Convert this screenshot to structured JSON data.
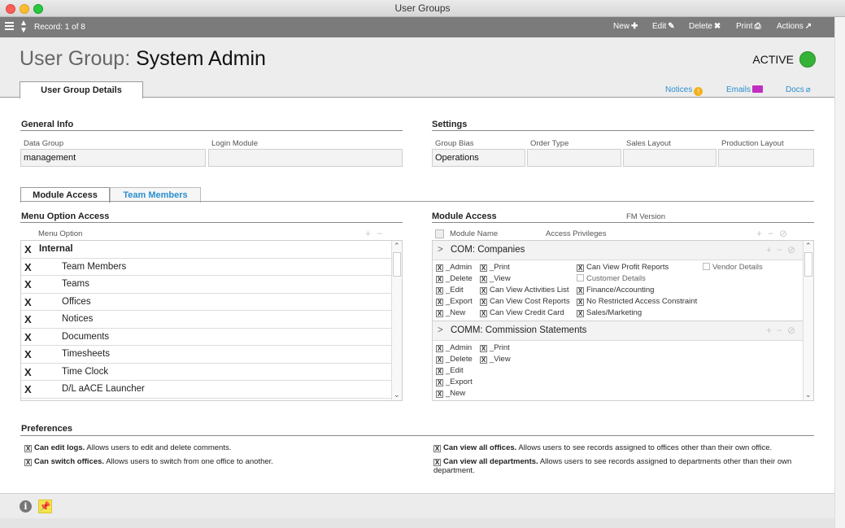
{
  "window": {
    "title": "User Groups"
  },
  "toolbar": {
    "record_label": "Record: 1 of 8",
    "new_label": "New",
    "edit_label": "Edit",
    "delete_label": "Delete",
    "print_label": "Print",
    "actions_label": "Actions"
  },
  "header": {
    "title_prefix": "User Group:",
    "title_name": "System Admin",
    "status": "ACTIVE",
    "status_color": "#36b236",
    "main_tab": "User Group Details",
    "links": {
      "notices": "Notices",
      "emails": "Emails",
      "docs": "Docs"
    }
  },
  "general_info": {
    "title": "General Info",
    "data_group_label": "Data Group",
    "data_group_value": "management",
    "login_module_label": "Login Module",
    "login_module_value": ""
  },
  "settings": {
    "title": "Settings",
    "group_bias_label": "Group Bias",
    "group_bias_value": "Operations",
    "order_type_label": "Order Type",
    "order_type_value": "",
    "sales_layout_label": "Sales Layout",
    "sales_layout_value": "",
    "production_layout_label": "Production Layout",
    "production_layout_value": ""
  },
  "subtabs": {
    "module_access": "Module Access",
    "team_members": "Team Members"
  },
  "menu_option_access": {
    "title": "Menu Option Access",
    "column_header": "Menu Option",
    "rows": [
      {
        "label": "Internal",
        "checked": "X",
        "group": true
      },
      {
        "label": "Team Members",
        "checked": "X"
      },
      {
        "label": "Teams",
        "checked": "X"
      },
      {
        "label": "Offices",
        "checked": "X"
      },
      {
        "label": "Notices",
        "checked": "X"
      },
      {
        "label": "Documents",
        "checked": "X"
      },
      {
        "label": "Timesheets",
        "checked": "X"
      },
      {
        "label": "Time Clock",
        "checked": "X"
      },
      {
        "label": "D/L aACE Launcher",
        "checked": "X"
      }
    ]
  },
  "module_access": {
    "title": "Module Access",
    "fm_version_label": "FM Version",
    "col_module_name": "Module Name",
    "col_access_privileges": "Access Privileges",
    "modules": [
      {
        "name": "COM: Companies",
        "privileges": {
          "admin": "_Admin",
          "delete": "_Delete",
          "edit": "_Edit",
          "export": "_Export",
          "new": "_New",
          "print": "_Print",
          "view": "_View",
          "activities": "Can View Activities List",
          "cost": "Can View Cost Reports",
          "credit": "Can View Credit Card",
          "profit": "Can View Profit Reports",
          "customer": "Customer Details",
          "finance": "Finance/Accounting",
          "restricted": "No Restricted Access Constraint",
          "sales": "Sales/Marketing",
          "vendor": "Vendor Details"
        }
      },
      {
        "name": "COMM: Commission Statements",
        "privileges": {
          "admin": "_Admin",
          "delete": "_Delete",
          "edit": "_Edit",
          "export": "_Export",
          "new": "_New",
          "print": "_Print",
          "view": "_View"
        }
      }
    ]
  },
  "preferences": {
    "title": "Preferences",
    "items": [
      {
        "bold": "Can edit logs.",
        "text": "Allows users to edit and delete comments."
      },
      {
        "bold": "Can switch offices.",
        "text": "Allows users to switch from one office to another."
      },
      {
        "bold": "Can view all offices.",
        "text": "Allows users to see records assigned to offices other than their own office."
      },
      {
        "bold": "Can view all departments.",
        "text": "Allows users to see records assigned to departments other than their own department."
      }
    ]
  },
  "check_mark": "X"
}
